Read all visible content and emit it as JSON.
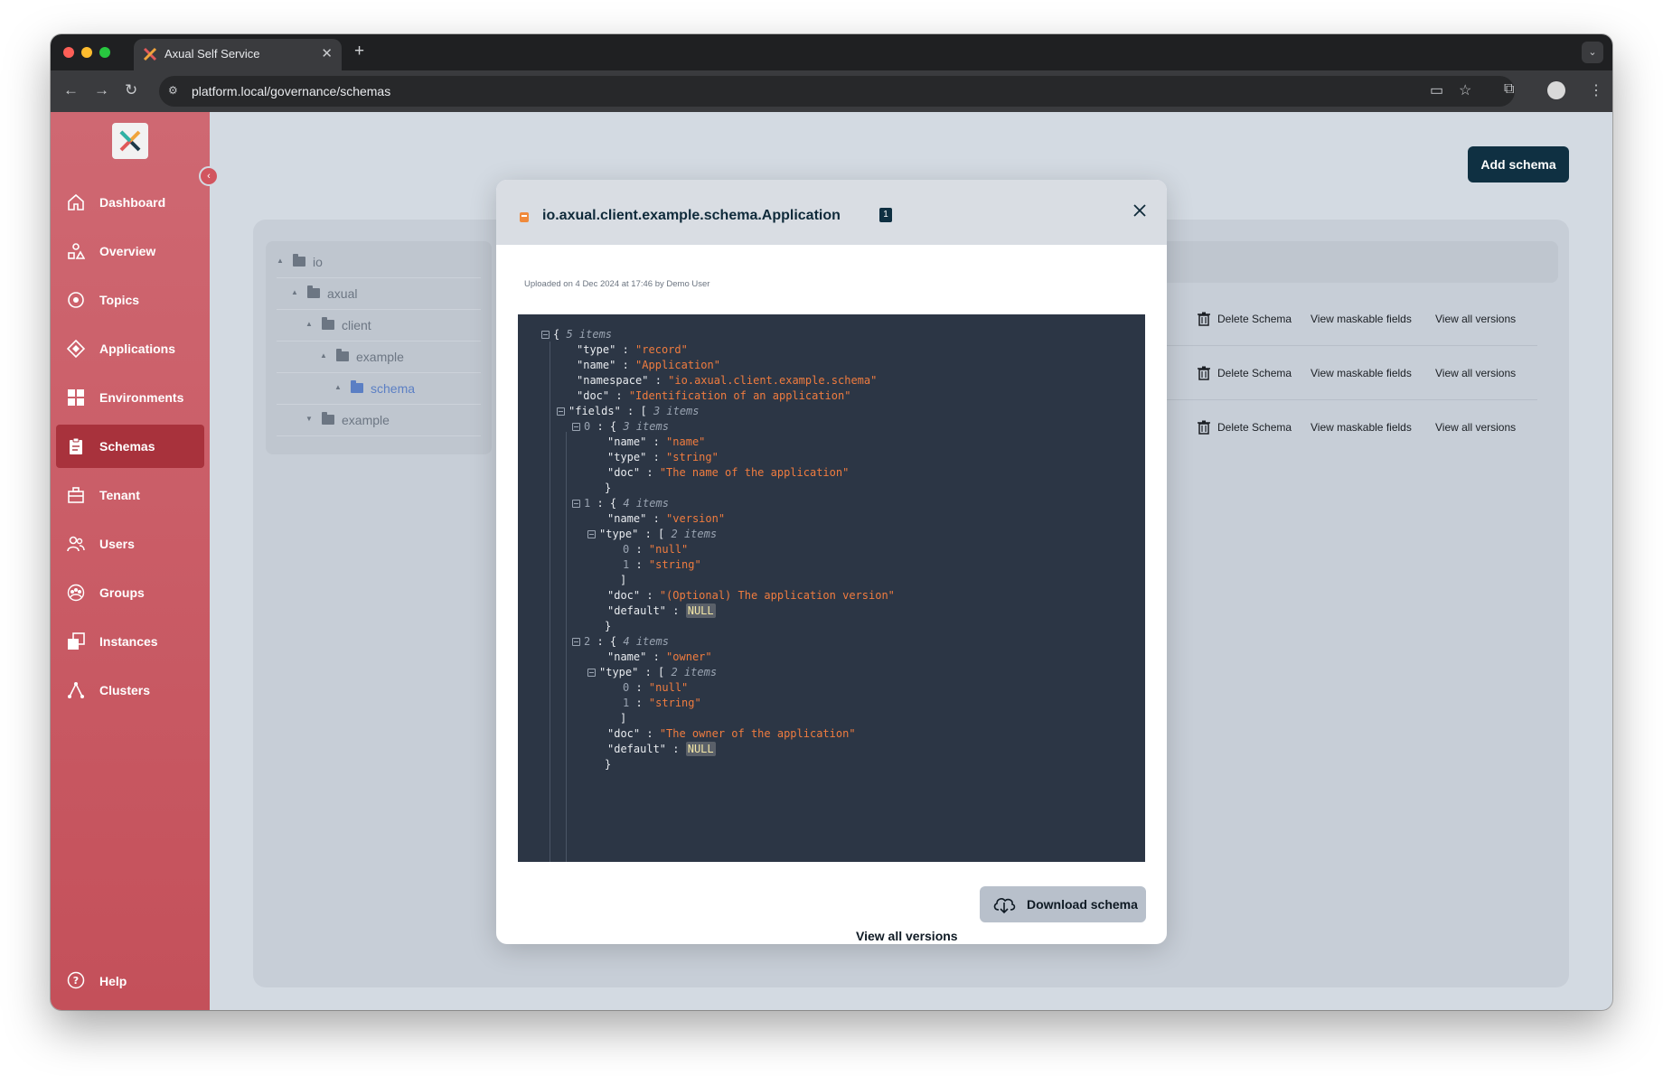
{
  "browser": {
    "tab_title": "Axual Self Service",
    "url": "platform.local/governance/schemas"
  },
  "sidebar": {
    "items": [
      {
        "label": "Dashboard",
        "icon": "home-icon"
      },
      {
        "label": "Overview",
        "icon": "overview-icon"
      },
      {
        "label": "Topics",
        "icon": "topic-icon"
      },
      {
        "label": "Applications",
        "icon": "application-icon"
      },
      {
        "label": "Environments",
        "icon": "grid-icon"
      },
      {
        "label": "Schemas",
        "icon": "clipboard-icon",
        "active": true
      },
      {
        "label": "Tenant",
        "icon": "tenant-icon"
      },
      {
        "label": "Users",
        "icon": "users-icon"
      },
      {
        "label": "Groups",
        "icon": "groups-icon"
      },
      {
        "label": "Instances",
        "icon": "instances-icon"
      },
      {
        "label": "Clusters",
        "icon": "clusters-icon"
      }
    ],
    "help_label": "Help"
  },
  "header": {
    "add_schema_label": "Add schema"
  },
  "tree": {
    "nodes": [
      {
        "label": "io",
        "expanded": true
      },
      {
        "label": "axual",
        "expanded": true
      },
      {
        "label": "client",
        "expanded": true
      },
      {
        "label": "example",
        "expanded": true
      },
      {
        "label": "schema",
        "selected": true
      },
      {
        "label": "example",
        "expanded": false
      }
    ]
  },
  "schema_list": {
    "rows": [
      {
        "delete_label": "Delete Schema",
        "maskable_label": "View maskable fields",
        "versions_label": "View all versions"
      },
      {
        "delete_label": "Delete Schema",
        "maskable_label": "View maskable fields",
        "versions_label": "View all versions"
      },
      {
        "delete_label": "Delete Schema",
        "maskable_label": "View maskable fields",
        "versions_label": "View all versions"
      }
    ]
  },
  "modal": {
    "title": "io.axual.client.example.schema.Application",
    "version_badge": "1",
    "upload_meta": "Uploaded on 4 Dec 2024 at 17:46 by Demo User",
    "view_all_versions_label": "View all versions",
    "download_label": "Download schema",
    "json_lines": [
      {
        "depth": 0,
        "toggle": true,
        "key": "",
        "open": "{",
        "count": "5 items"
      },
      {
        "depth": 1,
        "key": "type",
        "value": "\"record\""
      },
      {
        "depth": 1,
        "key": "name",
        "value": "\"Application\""
      },
      {
        "depth": 1,
        "key": "namespace",
        "value": "\"io.axual.client.example.schema\""
      },
      {
        "depth": 1,
        "key": "doc",
        "value": "\"Identification of an application\""
      },
      {
        "depth": 1,
        "toggle": true,
        "key": "fields",
        "open": "[",
        "count": "3 items"
      },
      {
        "depth": 2,
        "toggle": true,
        "idx": "0",
        "open": "{",
        "count": "3 items"
      },
      {
        "depth": 3,
        "key": "name",
        "value": "\"name\""
      },
      {
        "depth": 3,
        "key": "type",
        "value": "\"string\""
      },
      {
        "depth": 3,
        "key": "doc",
        "value": "\"The name of the application\""
      },
      {
        "depth": 2,
        "close": "}"
      },
      {
        "depth": 2,
        "toggle": true,
        "idx": "1",
        "open": "{",
        "count": "4 items"
      },
      {
        "depth": 3,
        "key": "name",
        "value": "\"version\""
      },
      {
        "depth": 3,
        "toggle": true,
        "key": "type",
        "open": "[",
        "count": "2 items"
      },
      {
        "depth": 4,
        "idx": "0",
        "value": "\"null\""
      },
      {
        "depth": 4,
        "idx": "1",
        "value": "\"string\""
      },
      {
        "depth": 3,
        "close": "]"
      },
      {
        "depth": 3,
        "key": "doc",
        "value": "\"(Optional) The application version\""
      },
      {
        "depth": 3,
        "key": "default",
        "null_value": "NULL"
      },
      {
        "depth": 2,
        "close": "}"
      },
      {
        "depth": 2,
        "toggle": true,
        "idx": "2",
        "open": "{",
        "count": "4 items"
      },
      {
        "depth": 3,
        "key": "name",
        "value": "\"owner\""
      },
      {
        "depth": 3,
        "toggle": true,
        "key": "type",
        "open": "[",
        "count": "2 items"
      },
      {
        "depth": 4,
        "idx": "0",
        "value": "\"null\""
      },
      {
        "depth": 4,
        "idx": "1",
        "value": "\"string\""
      },
      {
        "depth": 3,
        "close": "]"
      },
      {
        "depth": 3,
        "key": "doc",
        "value": "\"The owner of the application\""
      },
      {
        "depth": 3,
        "key": "default",
        "null_value": "NULL"
      },
      {
        "depth": 2,
        "close": "}"
      }
    ]
  },
  "colors": {
    "sidebar_top": "#cf6872",
    "sidebar_active": "#a8323c",
    "primary_button": "#0f3042",
    "json_bg": "#2c3645",
    "json_string": "#f07c3f"
  }
}
